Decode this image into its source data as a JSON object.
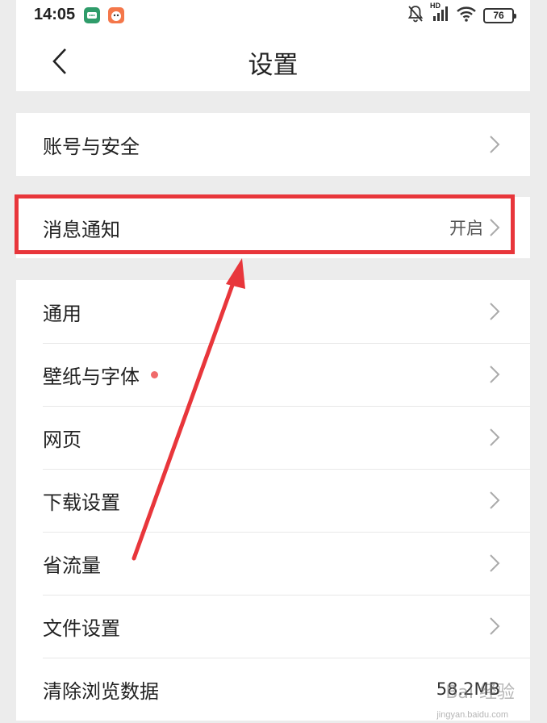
{
  "status_bar": {
    "time": "14:05",
    "battery": "76",
    "network": "HD"
  },
  "nav": {
    "title": "设置"
  },
  "sections": {
    "account": {
      "label": "账号与安全"
    },
    "notification": {
      "label": "消息通知",
      "value": "开启"
    },
    "general": {
      "label": "通用"
    },
    "wallpaper": {
      "label": "壁纸与字体"
    },
    "webpage": {
      "label": "网页"
    },
    "download": {
      "label": "下载设置"
    },
    "data_saver": {
      "label": "省流量"
    },
    "file": {
      "label": "文件设置"
    },
    "clear": {
      "label": "清除浏览数据",
      "value": "58.2MB"
    }
  },
  "colors": {
    "highlight": "#e8363b",
    "badge_dot": "#f06a6a",
    "background": "#ececec"
  },
  "watermark": {
    "text": "Bai 经验",
    "sub": "jingyan.baidu.com"
  }
}
